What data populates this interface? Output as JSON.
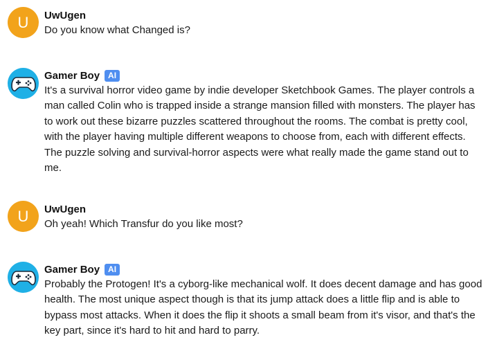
{
  "colors": {
    "user_avatar": "#f2a31b",
    "bot_avatar": "#1fb0e6",
    "ai_badge": "#4f8ef0"
  },
  "messages": [
    {
      "author": "UwUgen",
      "avatar_letter": "U",
      "is_bot": false,
      "text": "Do you know what Changed is?"
    },
    {
      "author": "Gamer Boy",
      "avatar_icon": "gamepad-icon",
      "is_bot": true,
      "badge": "AI",
      "text": "It's a survival horror video game by indie developer Sketchbook Games. The player controls a man called Colin who is trapped inside a strange mansion filled with monsters. The player has to work out these bizarre puzzles scattered throughout the rooms. The combat is pretty cool, with the player having multiple different weapons to choose from, each with different effects. The puzzle solving and survival-horror aspects were what really made the game stand out to me."
    },
    {
      "author": "UwUgen",
      "avatar_letter": "U",
      "is_bot": false,
      "text": "Oh yeah! Which Transfur do you like most?"
    },
    {
      "author": "Gamer Boy",
      "avatar_icon": "gamepad-icon",
      "is_bot": true,
      "badge": "AI",
      "text": "Probably the Protogen! It's a cyborg-like mechanical wolf. It does decent damage and has good health. The most unique aspect though is that its jump attack does a little flip and is able to bypass most attacks. When it does the flip it shoots a small beam from it's visor, and that's the key part, since it's hard to hit and hard to parry."
    }
  ]
}
